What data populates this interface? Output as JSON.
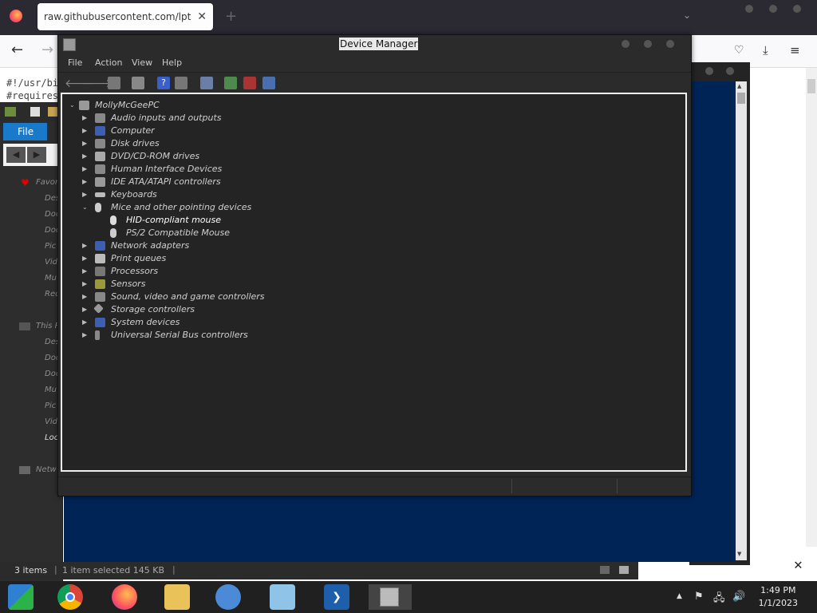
{
  "browser": {
    "tab_title": "raw.githubusercontent.com/lptstr/w",
    "tab_close": "✕",
    "new_tab": "+",
    "content_lines": [
      "#!/usr/bi",
      "#requires"
    ]
  },
  "explorer": {
    "file_tab": "File",
    "items": [
      "Favori",
      "Des",
      "Doc",
      "Doc",
      "Pic",
      "Vid",
      "Mu",
      "Rec",
      "This P",
      "Des",
      "Doc",
      "Doc",
      "Mu",
      "Pic",
      "Vid",
      "Loc",
      "Netw"
    ],
    "status_items": "3 items",
    "status_selected": "1 item selected  145 KB"
  },
  "device_manager": {
    "title": "Device Manager",
    "menu": [
      "File",
      "Action",
      "View",
      "Help"
    ],
    "root": "MollyMcGeePC",
    "categories": [
      {
        "label": "Audio inputs and outputs",
        "icon": "speaker-icon",
        "expanded": false
      },
      {
        "label": "Computer",
        "icon": "monitor-icon",
        "expanded": false
      },
      {
        "label": "Disk drives",
        "icon": "disk-icon",
        "expanded": false
      },
      {
        "label": "DVD/CD-ROM drives",
        "icon": "dvd-icon",
        "expanded": false
      },
      {
        "label": "Human Interface Devices",
        "icon": "hid-icon",
        "expanded": false
      },
      {
        "label": "IDE ATA/ATAPI controllers",
        "icon": "ide-icon",
        "expanded": false
      },
      {
        "label": "Keyboards",
        "icon": "keyboard-icon",
        "expanded": false
      },
      {
        "label": "Mice and other pointing devices",
        "icon": "mouse-icon",
        "expanded": true
      },
      {
        "label": "HID-compliant mouse",
        "icon": "mouse-icon",
        "child": true,
        "selected": true
      },
      {
        "label": "PS/2 Compatible Mouse",
        "icon": "mouse-icon",
        "child": true
      },
      {
        "label": "Network adapters",
        "icon": "network-icon",
        "expanded": false
      },
      {
        "label": "Print queues",
        "icon": "printer-icon",
        "expanded": false
      },
      {
        "label": "Processors",
        "icon": "cpu-icon",
        "expanded": false
      },
      {
        "label": "Sensors",
        "icon": "sensor-icon",
        "expanded": false
      },
      {
        "label": "Sound, video and game controllers",
        "icon": "speaker-icon",
        "expanded": false
      },
      {
        "label": "Storage controllers",
        "icon": "storage-icon",
        "expanded": false
      },
      {
        "label": "System devices",
        "icon": "system-icon",
        "expanded": false
      },
      {
        "label": "Universal Serial Bus controllers",
        "icon": "usb-icon",
        "expanded": false
      }
    ]
  },
  "taskbar": {
    "time": "1:49 PM",
    "date": "1/1/2023"
  },
  "colors": {
    "powershell_blue": "#012456",
    "dark_bg": "#242424",
    "taskbar": "#202020"
  }
}
